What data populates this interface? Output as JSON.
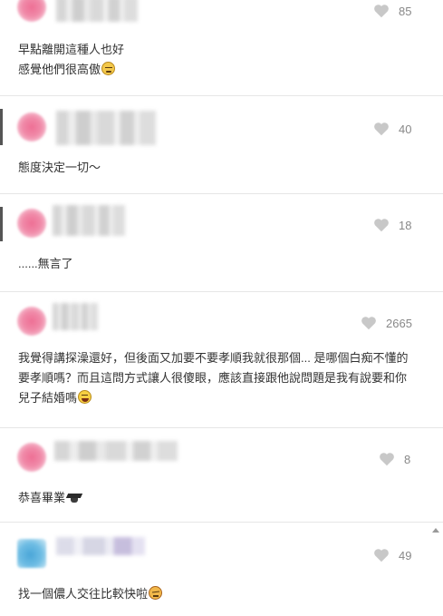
{
  "comments": [
    {
      "likes": "85",
      "text": "早點離開這種人也好\n感覺他們很高傲",
      "emoji": "sweat-emoji"
    },
    {
      "likes": "40",
      "text": "態度決定一切～",
      "emoji": ""
    },
    {
      "likes": "18",
      "text": "......無言了",
      "emoji": ""
    },
    {
      "likes": "2665",
      "text": "我覺得講探澡還好，但後面又加要不要孝順我就很那個... 是哪個白痴不懂的\n要孝順嗎？而且這問方式讓人很傻眼，應該直接跟他說問題是我有說要和你\n兒子結婚嗎",
      "emoji": "laugh-emoji"
    },
    {
      "likes": "8",
      "text": "恭喜畢業",
      "emoji": "graduation-cap-emoji"
    },
    {
      "likes": "49",
      "text": "找一個儂人交往比較快啦",
      "emoji": "angry-emoji"
    }
  ],
  "colors": {
    "heart": "#c8c8c8",
    "count": "#888888",
    "divider": "#e6e6e6",
    "avatar_pink": "#ee6f95",
    "avatar_blue": "#4aa6d8"
  },
  "icons": {
    "like": "heart-icon"
  }
}
